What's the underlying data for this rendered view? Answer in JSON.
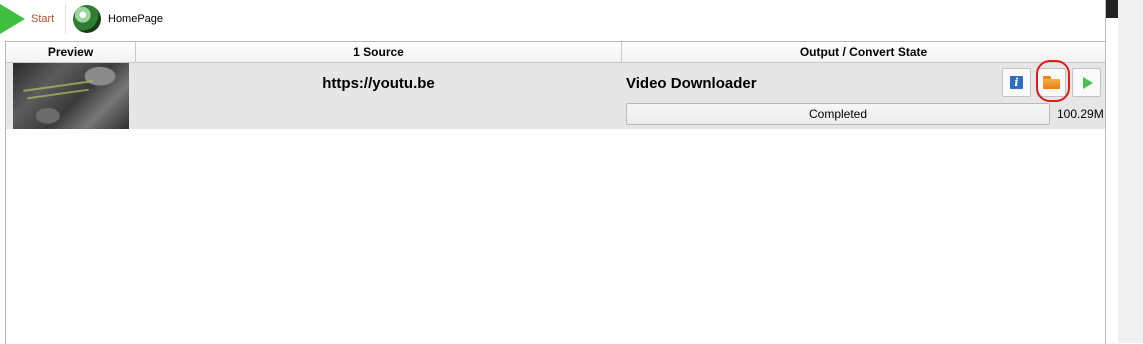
{
  "toolbar": {
    "start_label": "Start",
    "homepage_label": "HomePage"
  },
  "table": {
    "headers": {
      "preview": "Preview",
      "source": "1 Source",
      "output": "Output / Convert State"
    },
    "rows": [
      {
        "source_url": "https://youtu.be",
        "output_title": "Video Downloader",
        "status": "Completed",
        "progress_percent": 100,
        "size": "100.29M"
      }
    ]
  },
  "icons": {
    "start": "play-icon",
    "homepage": "globe-icon",
    "info": "info-icon",
    "folder": "folder-icon",
    "play": "play-icon"
  },
  "colors": {
    "start_green": "#3fbf3f",
    "start_text": "#b5502a",
    "info_blue": "#2e6dc4",
    "folder_orange": "#f0a030",
    "highlight_red": "#e01b1b",
    "row_background": "#e6e6e6"
  }
}
